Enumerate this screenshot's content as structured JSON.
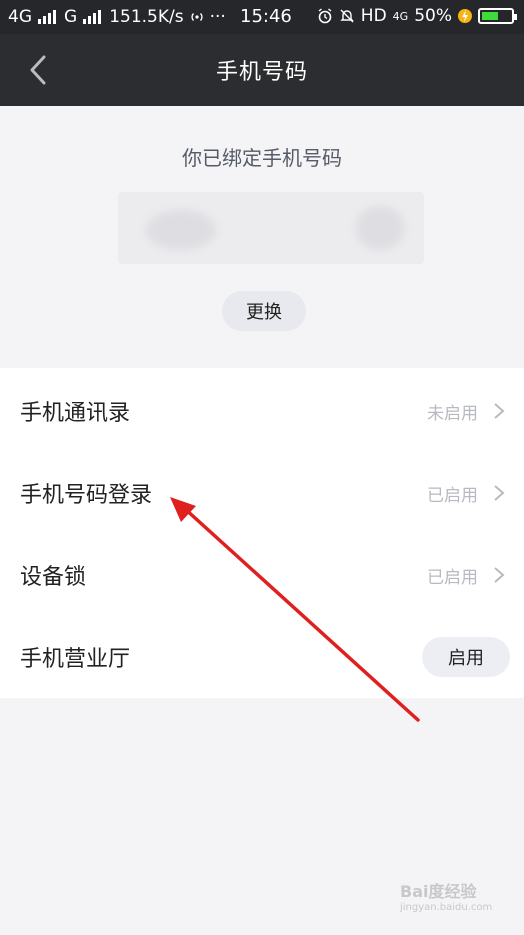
{
  "status_bar": {
    "network_left": "4G",
    "network_right": "G",
    "speed": "151.5K/s",
    "more": "···",
    "time": "15:46",
    "hd": "HD",
    "signal_label": "4G",
    "battery_percent": "50%",
    "battery_level": 0.5
  },
  "navbar": {
    "back_icon": "chevron-left-icon",
    "title": "手机号码"
  },
  "bound": {
    "text": "你已绑定手机号码",
    "change_label": "更换"
  },
  "settings": {
    "items": [
      {
        "label": "手机通讯录",
        "status": "未启用"
      },
      {
        "label": "手机号码登录",
        "status": "已启用"
      },
      {
        "label": "设备锁",
        "status": "已启用"
      },
      {
        "label": "手机营业厅",
        "button": "启用"
      }
    ]
  },
  "watermark": {
    "text": "Bai度经验",
    "sub": "jingyan.baidu.com"
  },
  "colors": {
    "header_bg": "#2c2d31",
    "annotation_arrow": "#e0201e",
    "battery_fill": "#3ddc3b"
  }
}
